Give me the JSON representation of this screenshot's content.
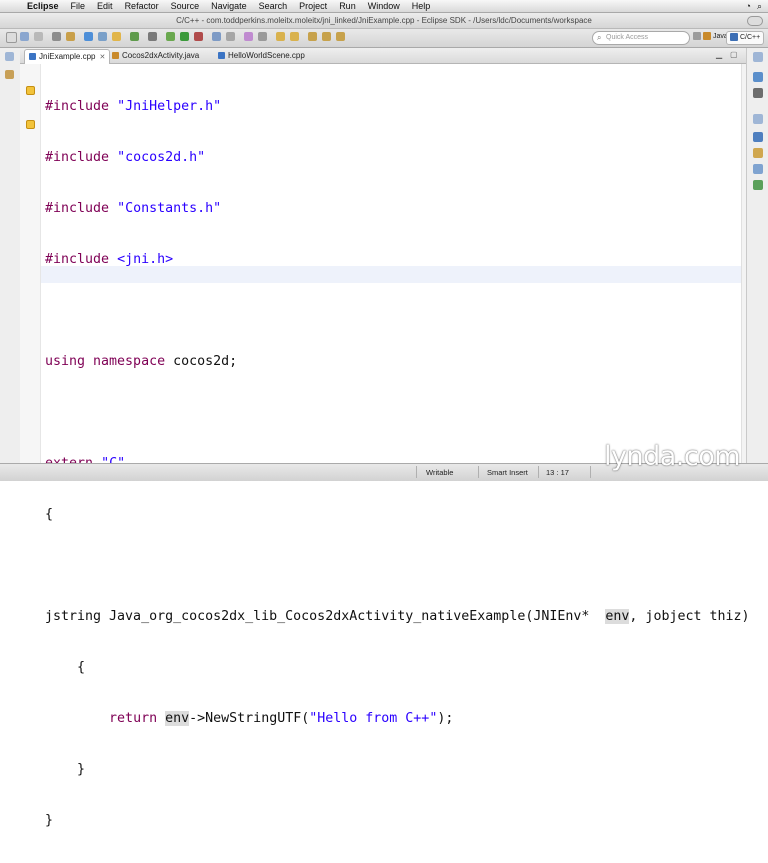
{
  "menubar": {
    "app": "Eclipse",
    "items": [
      "File",
      "Edit",
      "Refactor",
      "Source",
      "Navigate",
      "Search",
      "Project",
      "Run",
      "Window",
      "Help"
    ]
  },
  "window": {
    "title": "C/C++ - com.toddperkins.moleitx.moleitx/jni_linked/JniExample.cpp - Eclipse SDK - /Users/ldc/Documents/workspace"
  },
  "toolbar": {
    "quick_access_placeholder": "Quick Access",
    "perspectives": [
      {
        "label": "Java",
        "color": "#c98a2b"
      },
      {
        "label": "C/C++",
        "color": "#3d6fb5"
      }
    ]
  },
  "tabs": [
    {
      "label": "JniExample.cpp",
      "active": true,
      "icon_color": "#3b74c4",
      "close": "✕"
    },
    {
      "label": "Cocos2dxActivity.java",
      "active": false,
      "icon_color": "#c98a2b"
    },
    {
      "label": "HelloWorldScene.cpp",
      "active": false,
      "icon_color": "#3b74c4"
    }
  ],
  "editor": {
    "lines": [
      "#include \"JniHelper.h\"",
      "#include \"cocos2d.h\"",
      "#include \"Constants.h\"",
      "#include <jni.h>",
      "",
      "using namespace cocos2d;",
      "",
      "extern \"C\"",
      "{",
      "",
      "jstring Java_org_cocos2dx_lib_Cocos2dxActivity_nativeExample(JNIEnv*  env, jobject thiz)",
      "    {",
      "        return env->NewStringUTF(\"Hello from C++\");",
      "    }",
      "}"
    ],
    "warning_lines": [
      2,
      4
    ],
    "current_line": 13
  },
  "status": {
    "writable": "Writable",
    "insert_mode": "Smart Insert",
    "position": "13 : 17"
  },
  "watermark": "lynda.com",
  "colors": {
    "keyword": "#7f0055",
    "string": "#2a00ff",
    "current_line_bg": "#eef2fb",
    "warning_marker": "#f2c33b"
  }
}
